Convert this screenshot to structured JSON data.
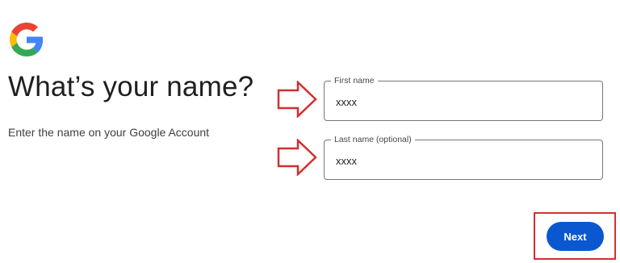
{
  "header": {
    "logo_icon": "google-g-logo",
    "title": "What’s your name?",
    "subtitle": "Enter the name on your Google Account"
  },
  "form": {
    "first_name": {
      "label": "First name",
      "value": "xxxx"
    },
    "last_name": {
      "label": "Last name (optional)",
      "value": "xxxx"
    }
  },
  "actions": {
    "next_label": "Next"
  },
  "annotations": {
    "arrow_icon": "right-arrow-icon",
    "color": "#d32f2f"
  },
  "colors": {
    "accent": "#0b57d0",
    "field_border": "#747775",
    "annotation_red": "#d32f2f"
  }
}
